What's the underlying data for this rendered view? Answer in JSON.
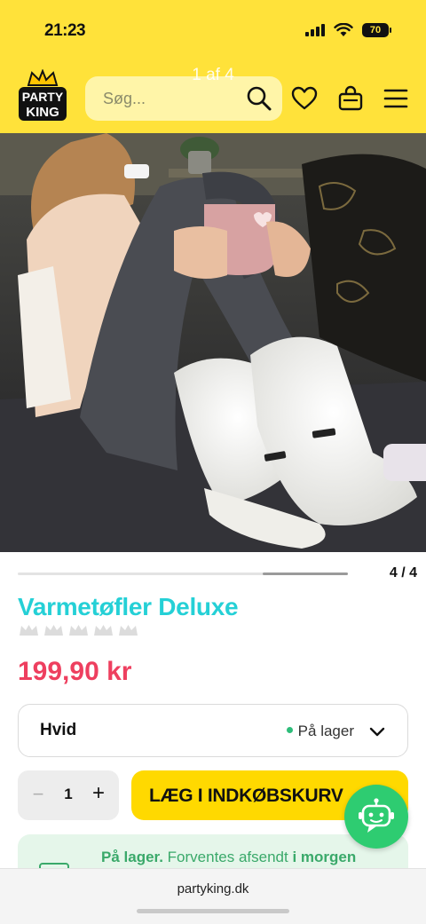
{
  "status_bar": {
    "time": "21:23",
    "battery": "70"
  },
  "header": {
    "logo_text_top": "PARTY",
    "logo_text_bottom": "KING",
    "image_pager": "1 af 4",
    "search": {
      "placeholder": "Søg..."
    },
    "icons": [
      "search-icon",
      "heart-icon",
      "bag-icon",
      "menu-icon"
    ]
  },
  "gallery": {
    "counter": "4 / 4",
    "current": 4,
    "total": 4
  },
  "product": {
    "name": "Varmetøfler Deluxe",
    "rating_crowns": 0,
    "rating_max": 5,
    "price": "199,90 kr"
  },
  "variant": {
    "selected": "Hvid",
    "stock": "På lager"
  },
  "quantity": {
    "minus": "−",
    "value": "1",
    "plus": "+"
  },
  "cart": {
    "button_label": "LÆG I INDKØBSKURV"
  },
  "delivery": {
    "bold1": "På lager.",
    "text": " Forventes afsendt ",
    "bold2": "i morgen"
  },
  "browser": {
    "url": "partyking.dk"
  },
  "colors": {
    "brand_yellow": "#ffe23a",
    "title_cyan": "#25d0d6",
    "price_red": "#ee3f5f",
    "stock_green": "#2ebd7a",
    "cart_yellow": "#ffd900",
    "chat_green": "#2ecc71"
  }
}
